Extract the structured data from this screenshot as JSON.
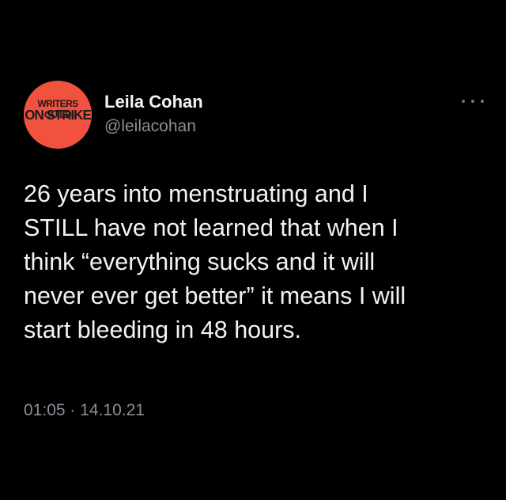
{
  "avatar": {
    "line1": "WRITERS GUILD",
    "line2": "ON STRIKE",
    "background_color": "#f0523f"
  },
  "author": {
    "display_name": "Leila Cohan",
    "handle": "@leilacohan"
  },
  "menu": {
    "icon": "more-horizontal-icon"
  },
  "tweet": {
    "text": "26 years into menstruating and I\nSTILL have not learned that when I\nthink “everything sucks and it will\nnever ever get better” it means I will\nstart bleeding in 48 hours.",
    "timestamp": "01:05 · 14.10.21"
  },
  "colors": {
    "background": "#000000",
    "primary_text": "#f2f3f4",
    "secondary_text": "#8b9096"
  }
}
